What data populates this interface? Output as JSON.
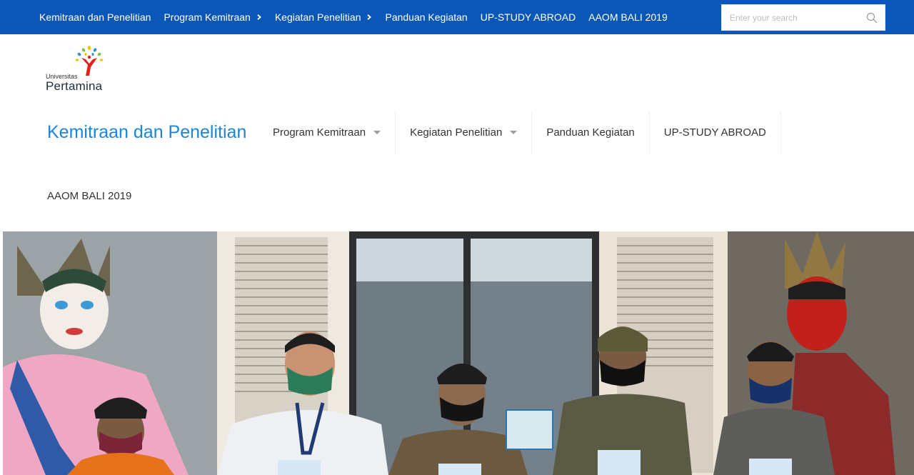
{
  "topbar": {
    "items": [
      {
        "label": "Kemitraan dan Penelitian",
        "has_submenu": false
      },
      {
        "label": "Program Kemitraan",
        "has_submenu": true
      },
      {
        "label": "Kegiatan Penelitian",
        "has_submenu": true
      },
      {
        "label": "Panduan Kegiatan",
        "has_submenu": false
      },
      {
        "label": "UP-STUDY ABROAD",
        "has_submenu": false
      },
      {
        "label": "AAOM BALI 2019",
        "has_submenu": false
      }
    ],
    "search_placeholder": "Enter your search",
    "search_value": "",
    "background_color": "#0a57b8"
  },
  "logo": {
    "line1": "Universitas",
    "line2": "Pertamina"
  },
  "site_title": "Kemitraan dan Penelitian",
  "mainnav": {
    "items": [
      {
        "label": "Program Kemitraan",
        "has_dropdown": true
      },
      {
        "label": "Kegiatan Penelitian",
        "has_dropdown": true
      },
      {
        "label": "Panduan Kegiatan",
        "has_dropdown": false
      },
      {
        "label": "UP-STUDY ABROAD",
        "has_dropdown": false
      },
      {
        "label": "AAOM BALI 2019",
        "has_dropdown": false
      }
    ],
    "title_color": "#1a86d8"
  }
}
